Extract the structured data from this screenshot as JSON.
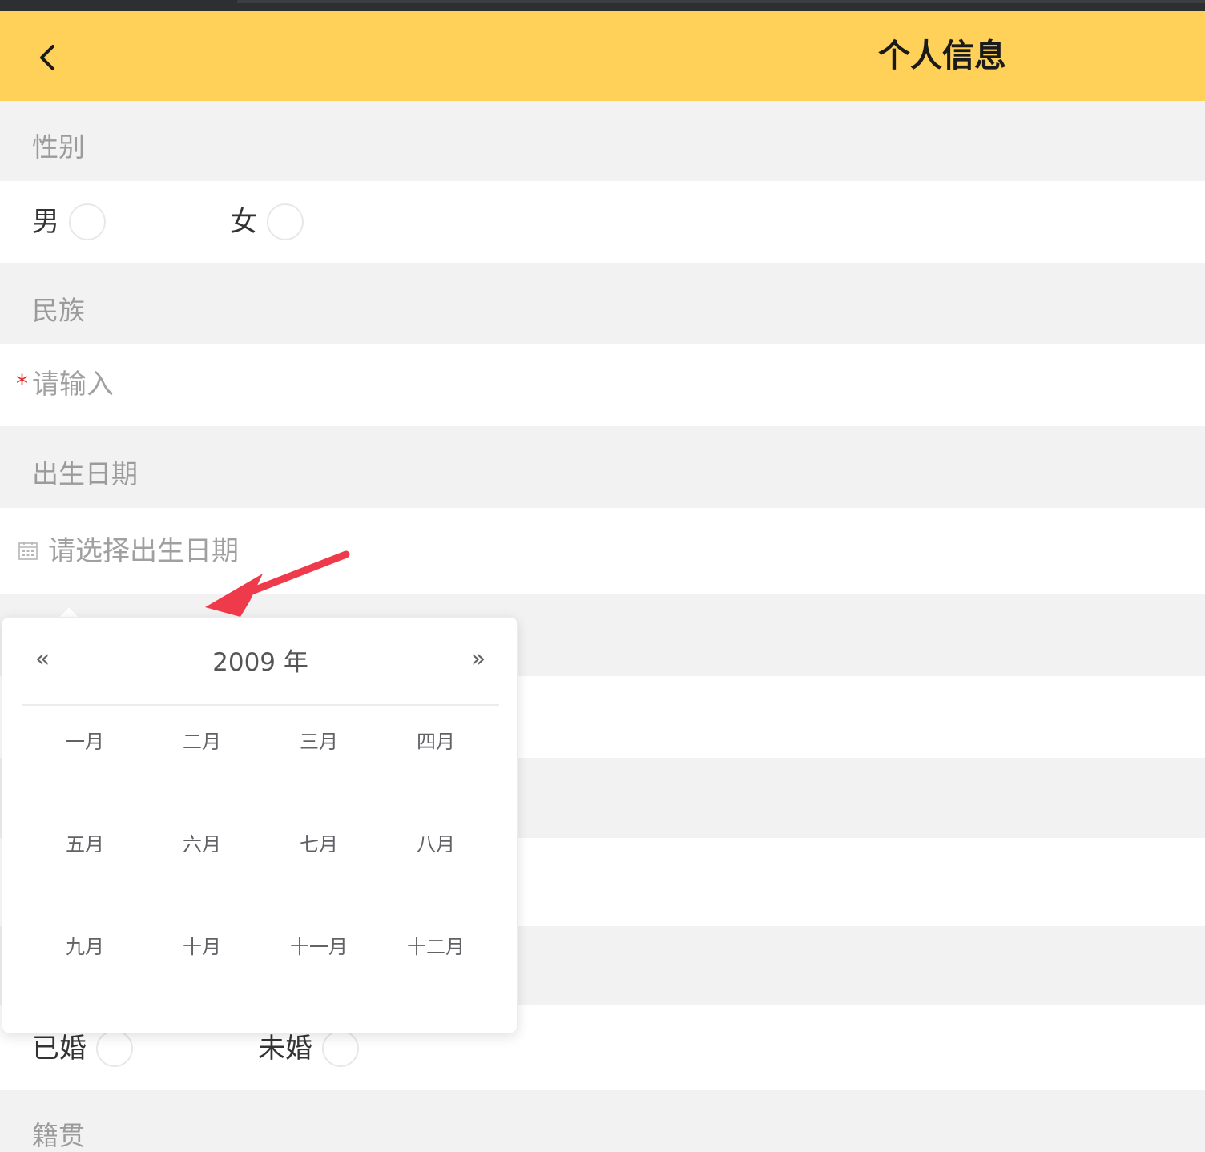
{
  "header": {
    "title": "个人信息",
    "back_icon": "chevron-left-icon",
    "background_color": "#ffd159"
  },
  "gender": {
    "label": "性别",
    "options": [
      "男",
      "女"
    ]
  },
  "ethnicity": {
    "label": "民族",
    "placeholder": "请输入",
    "required_mark": "*"
  },
  "birthdate": {
    "label": "出生日期",
    "placeholder": "请选择出生日期",
    "icon": "calendar-icon"
  },
  "date_picker": {
    "year_label": "2009 年",
    "prev_label": "«",
    "next_label": "»",
    "months": [
      "一月",
      "二月",
      "三月",
      "四月",
      "五月",
      "六月",
      "七月",
      "八月",
      "九月",
      "十月",
      "十一月",
      "十二月"
    ]
  },
  "marital": {
    "options": [
      "已婚",
      "未婚"
    ]
  },
  "native_place": {
    "label": "籍贯"
  },
  "annotation": {
    "arrow_color": "#ef3a4c"
  }
}
